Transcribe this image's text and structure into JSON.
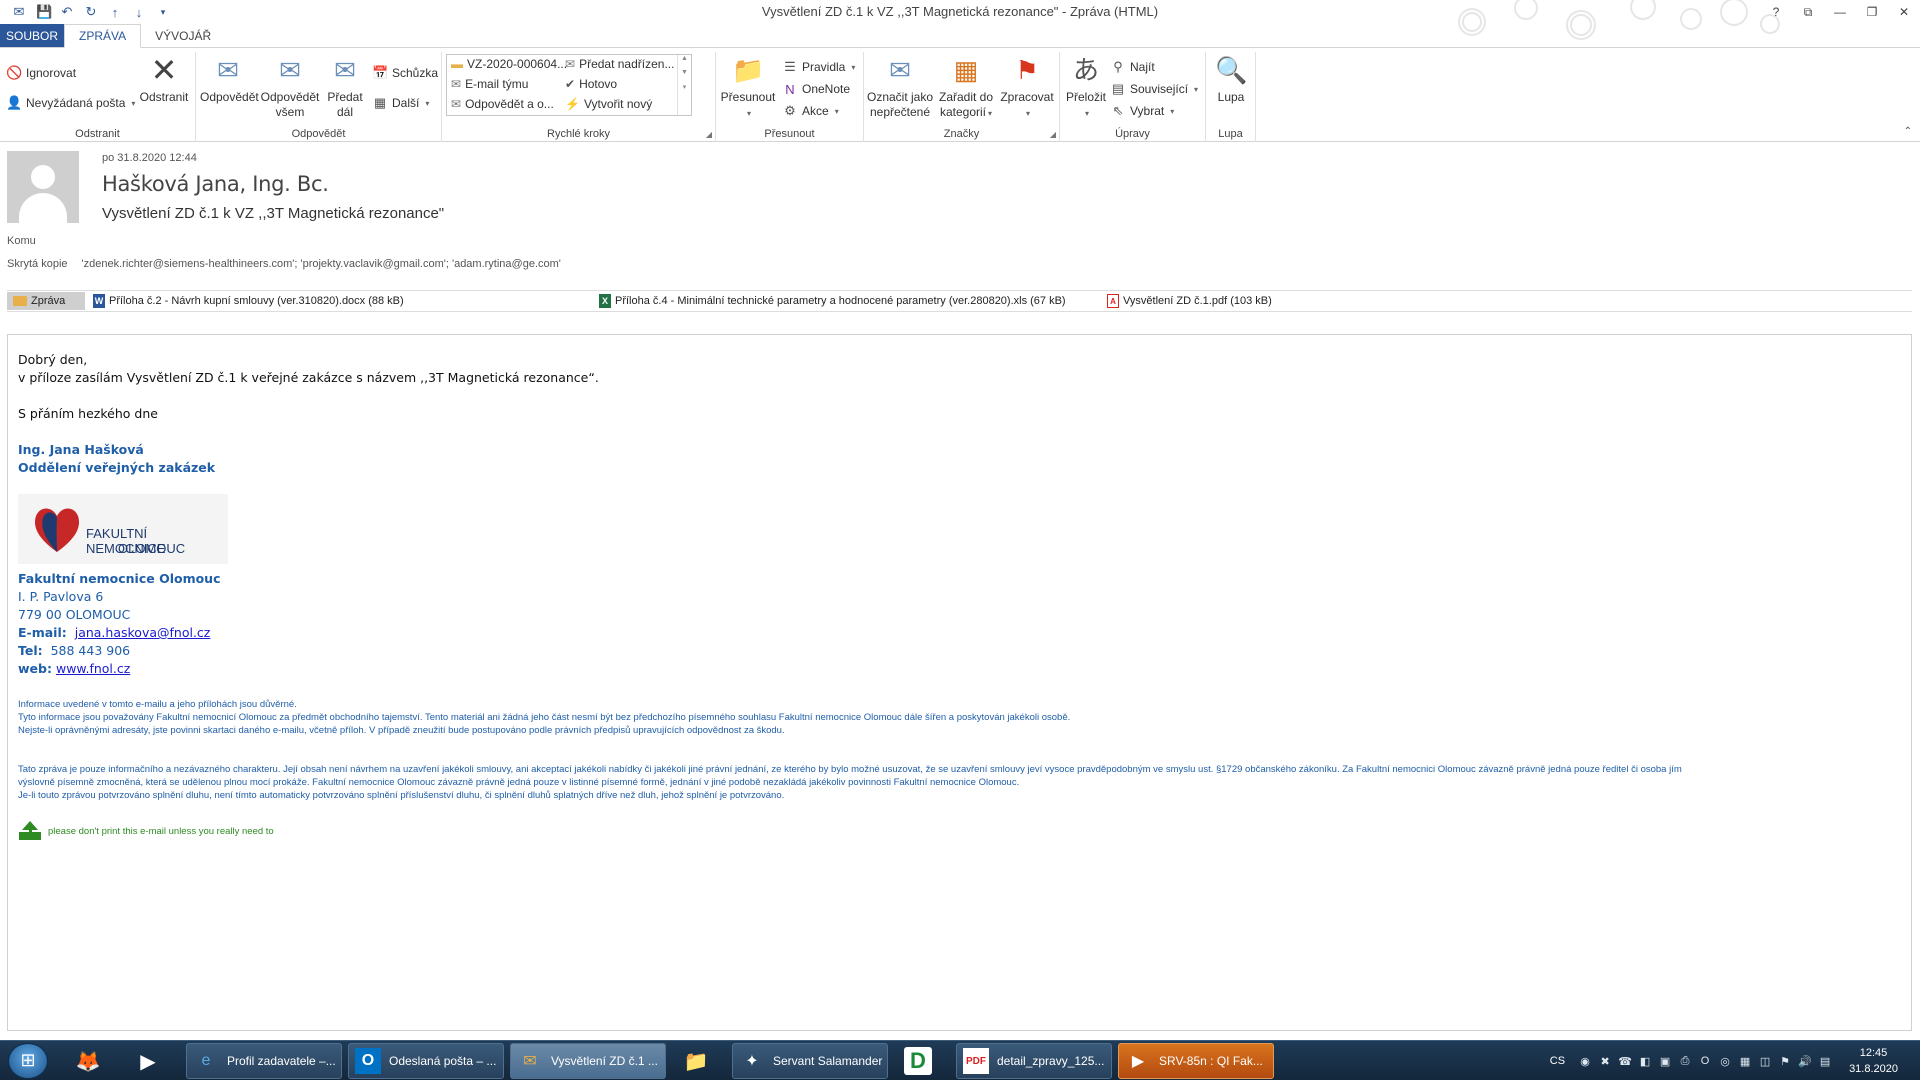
{
  "window": {
    "title": "Vysvětlení ZD č.1 k VZ ,,3T Magnetická rezonance\" - Zpráva (HTML)",
    "controls": [
      "?",
      "⧉",
      "—",
      "❐",
      "✕"
    ]
  },
  "tabs": [
    "SOUBOR",
    "ZPRÁVA",
    "VÝVOJÁŘ"
  ],
  "ribbon": {
    "delete_group": {
      "label": "Odstranit",
      "ignore": "Ignorovat",
      "junk": "Nevyžádaná pošta",
      "delete": "Odstranit"
    },
    "respond_group": {
      "label": "Odpovědět",
      "reply": "Odpovědět",
      "reply_all_1": "Odpovědět",
      "reply_all_2": "všem",
      "forward_1": "Předat",
      "forward_2": "dál",
      "meeting": "Schůzka",
      "more": "Další"
    },
    "quicksteps_group": {
      "label": "Rychlé kroky",
      "items": [
        "VZ-2020-000604...",
        "E-mail týmu",
        "Odpovědět a o...",
        "Předat nadřízen...",
        "Hotovo",
        "Vytvořit nový"
      ]
    },
    "move_group": {
      "label": "Přesunout",
      "move": "Přesunout",
      "rules": "Pravidla",
      "onenote": "OneNote",
      "actions": "Akce"
    },
    "tags_group": {
      "label": "Značky",
      "mark_unread_1": "Označit jako",
      "mark_unread_2": "nepřečtené",
      "categorize_1": "Zařadit do",
      "categorize_2": "kategorií",
      "followup": "Zpracovat"
    },
    "edit_group": {
      "label": "Úpravy",
      "translate": "Přeložit",
      "find": "Najít",
      "related": "Související",
      "select": "Vybrat"
    },
    "zoom_group": {
      "label": "Lupa",
      "zoom": "Lupa"
    }
  },
  "message": {
    "date": "po 31.8.2020 12:44",
    "sender": "Hašková Jana, Ing. Bc.",
    "subject": "Vysvětlení ZD č.1 k VZ ,,3T Magnetická rezonance\"",
    "to_label": "Komu",
    "bcc_label": "Skrytá kopie",
    "bcc_value": "'zdenek.richter@siemens-healthineers.com'; 'projekty.vaclavik@gmail.com'; 'adam.rytina@ge.com'",
    "attachments": {
      "message_tab": "Zpráva",
      "files": [
        "Příloha č.2 - Návrh kupní smlouvy (ver.310820).docx (88 kB)",
        "Příloha č.4 - Minimální technické parametry a hodnocené parametry (ver.280820).xls (67 kB)",
        "Vysvětlení ZD č.1.pdf (103 kB)"
      ]
    }
  },
  "body": {
    "greeting": "Dobrý den,",
    "line1": "v příloze zasílám Vysvětlení ZD č.1 k veřejné zakázce s názvem ,,3T Magnetická rezonance“.",
    "closing": "S přáním hezkého dne",
    "sig_name": "Ing. Jana Hašková",
    "sig_dept": "Oddělení veřejných zakázek",
    "logo_line1": "FAKULTNÍ NEMOCNICE",
    "logo_line2": "OLOMOUC",
    "org": "Fakultní nemocnice Olomouc",
    "street": "I. P. Pavlova 6",
    "city": "779 00 OLOMOUC",
    "email_label": "E-mail:",
    "email": "jana.haskova@fnol.cz",
    "tel_label": "Tel:",
    "tel": "588 443 906",
    "web_label": "web:",
    "web": "www.fnol.cz",
    "disclaimer1": [
      "Informace uvedené v tomto e-mailu a jeho přílohách jsou důvěrné.",
      "Tyto informace jsou považovány Fakultní nemocnicí Olomouc za předmět obchodního tajemství. Tento materiál ani žádná jeho část nesmí být bez předchozího písemného souhlasu Fakultní nemocnice Olomouc dále šířen a poskytován jakékoli osobě.",
      "Nejste-li oprávněnými adresáty, jste povinni skartaci daného e-mailu, včetně příloh. V případě zneužití bude postupováno podle právních předpisů upravujících odpovědnost za škodu."
    ],
    "disclaimer2": [
      "Tato zpráva je pouze informačního a nezávazného charakteru. Její obsah není návrhem na uzavření jakékoli smlouvy, ani akceptací jakékoli nabídky či jakékoli jiné právní jednání, ze kterého by bylo možné usuzovat, že se uzavření smlouvy jeví vysoce pravděpodobným ve smyslu ust. §1729 občanského zákoníku. Za Fakultní nemocnici Olomouc závazně právně jedná pouze ředitel či osoba jím",
      "výslovně písemně zmocněná, která se udělenou plnou mocí prokáže. Fakultní nemocnice Olomouc závazně právně jedná pouze v listinné písemné formě, jednání v jiné podobě nezakládá jakékoliv povinnosti Fakultní nemocnice Olomouc.",
      "Je-li touto zprávou potvrzováno splnění dluhu, není tímto automaticky potvrzováno splnění příslušenství dluhu, či splnění dluhů splatných dříve než dluh, jehož splnění je potvrzováno."
    ],
    "eco": "please don't print this e-mail unless you really need to"
  },
  "taskbar": {
    "tasks": [
      "Profil zadavatele –...",
      "Odeslaná pošta – ...",
      "Vysvětlení ZD č.1 ...",
      "Servant Salamander",
      "detail_zpravy_125...",
      "SRV-85n : QI Fak..."
    ],
    "lang": "CS",
    "time": "12:45",
    "date": "31.8.2020"
  },
  "colors": {
    "accent": "#2b579a",
    "signature": "#1f5ea8",
    "link": "#1a1ad0",
    "eco": "#2e8b22"
  }
}
